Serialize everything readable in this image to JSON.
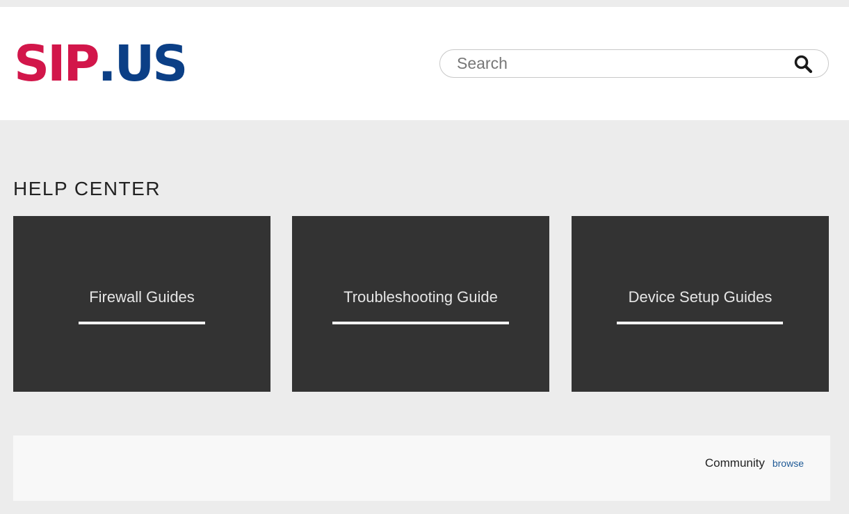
{
  "logo": {
    "part1": "SIP",
    "part2": ".US",
    "color_red": "#d2164a",
    "color_blue": "#0b3f86"
  },
  "search": {
    "placeholder": "Search",
    "value": "",
    "icon": "search-icon"
  },
  "main": {
    "section_title": "HELP CENTER",
    "cards": [
      {
        "label": "Firewall Guides"
      },
      {
        "label": "Troubleshooting Guide"
      },
      {
        "label": "Device Setup Guides"
      }
    ]
  },
  "footer": {
    "community_label": "Community",
    "browse_link": "browse"
  },
  "colors": {
    "page_bg": "#ececec",
    "header_bg": "#ffffff",
    "card_bg": "#333333",
    "card_text": "#e6e6e6",
    "link": "#1f5a96"
  }
}
